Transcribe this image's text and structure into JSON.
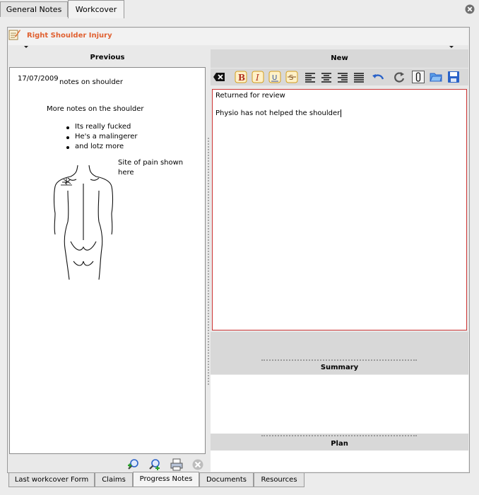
{
  "top_tabs": [
    {
      "label": "General Notes",
      "active": false
    },
    {
      "label": "Workcover",
      "active": true
    }
  ],
  "header": {
    "title": "Right Shoulder Injury"
  },
  "previous": {
    "header": "Previous",
    "date": "17/07/2009",
    "line1": "notes on shoulder",
    "line2": "More notes on the shoulder",
    "bullets": [
      "Its really fucked",
      "He's a malingerer",
      "and lotz more"
    ],
    "pain_text_1": "Site of pain shown",
    "pain_text_2": "here"
  },
  "new_note": {
    "header": "New",
    "lines": [
      "Returned for review",
      "Physio has not helped the shoulder"
    ]
  },
  "summary": {
    "header": "Summary"
  },
  "plan": {
    "header": "Plan"
  },
  "bottom_tabs": [
    {
      "label": "Last workcover Form",
      "active": false
    },
    {
      "label": "Claims",
      "active": false
    },
    {
      "label": "Progress Notes",
      "active": true
    },
    {
      "label": "Documents",
      "active": false
    },
    {
      "label": "Resources",
      "active": false
    }
  ],
  "colors": {
    "accent_title": "#e06030",
    "editor_border": "#cc3333"
  },
  "icons": [
    "close-tab-icon",
    "note-pad-icon",
    "clear-format-icon",
    "bold-icon",
    "italic-icon",
    "underline-icon",
    "strikethrough-icon",
    "align-left-icon",
    "align-center-icon",
    "align-right-icon",
    "justify-icon",
    "undo-icon",
    "refresh-icon",
    "attach-icon",
    "open-folder-icon",
    "save-icon",
    "zoom-in-icon",
    "zoom-out-icon",
    "print-icon",
    "cancel-icon"
  ]
}
